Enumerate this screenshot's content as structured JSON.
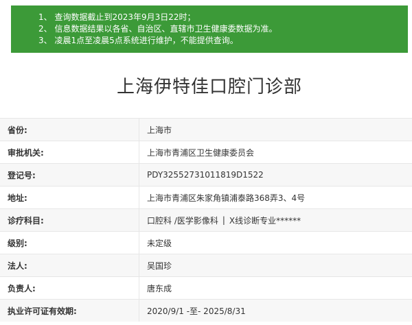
{
  "notice": {
    "lines": [
      "1、 查询数据截止到2023年9月3日22时；",
      "2、 信息数据结果以各省、自治区、直辖市卫生健康委数据为准。",
      "3、 凌晨1点至凌晨5点系统进行维护，不能提供查询。"
    ]
  },
  "title": "上海伊特佳口腔门诊部",
  "rows": [
    {
      "label": "省份:",
      "value": "上海市"
    },
    {
      "label": "审批机关:",
      "value": "上海市青浦区卫生健康委员会"
    },
    {
      "label": "登记号:",
      "value": "PDY32552731011819D1522"
    },
    {
      "label": "地址:",
      "value": "上海市青浦区朱家角镇浦泰路368弄3、4号"
    },
    {
      "label": "诊疗科目:",
      "value_parts": [
        "口腔科 /医学影像科",
        "|",
        "X线诊断专业******"
      ]
    },
    {
      "label": "级别:",
      "value": "未定级"
    },
    {
      "label": "法人:",
      "value": "吴国珍"
    },
    {
      "label": "负责人:",
      "value": "唐东成"
    },
    {
      "label": "执业许可证有效期:",
      "value": "2020/9/1 -至- 2025/8/31"
    }
  ],
  "colors": {
    "notice_bg": "#3c9a38"
  }
}
